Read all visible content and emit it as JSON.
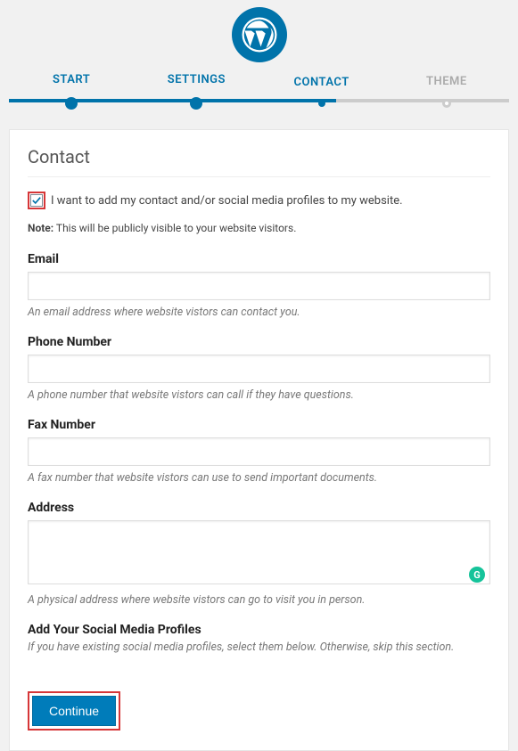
{
  "stepper": {
    "steps": [
      {
        "label": "START"
      },
      {
        "label": "SETTINGS"
      },
      {
        "label": "CONTACT"
      },
      {
        "label": "THEME"
      }
    ]
  },
  "page": {
    "heading": "Contact",
    "checkbox_label": "I want to add my contact and/or social media profiles to my website.",
    "note_bold": "Note:",
    "note_text": " This will be publicly visible to your website visitors."
  },
  "fields": {
    "email": {
      "label": "Email",
      "value": "",
      "help": "An email address where website vistors can contact you."
    },
    "phone": {
      "label": "Phone Number",
      "value": "",
      "help": "A phone number that website vistors can call if they have questions."
    },
    "fax": {
      "label": "Fax Number",
      "value": "",
      "help": "A fax number that website vistors can use to send important documents."
    },
    "address": {
      "label": "Address",
      "value": "",
      "help": "A physical address where website vistors can go to visit you in person."
    }
  },
  "social": {
    "title": "Add Your Social Media Profiles",
    "sub": "If you have existing social media profiles, select them below. Otherwise, skip this section."
  },
  "buttons": {
    "continue": "Continue"
  },
  "grammarly_glyph": "G"
}
